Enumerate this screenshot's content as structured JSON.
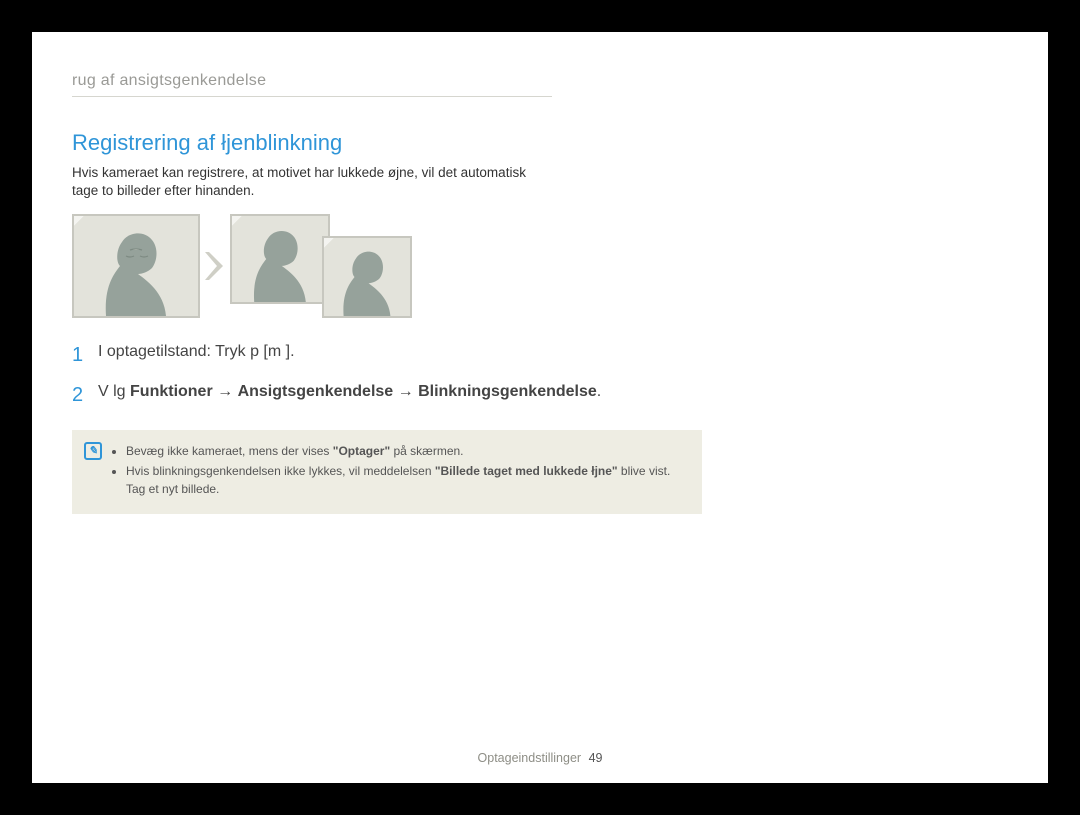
{
  "chapter": "rug af ansigtsgenkendelse",
  "section_title": "Registrering af łjenblinkning",
  "intro": "Hvis kameraet kan registrere, at motivet har lukkede øjne, vil det automatisk tage to billeder efter hinanden.",
  "steps": {
    "s1": {
      "num": "1",
      "text": "I optagetilstand: Tryk p  [m       ]."
    },
    "s2": {
      "num": "2",
      "seg1": "V lg  ",
      "seg2_bold": "Funktioner",
      "seg3": " → ",
      "seg4_bold": "Ansigtsgenkendelse",
      "seg5": " → ",
      "seg6_bold": "Blinkningsgenkendelse",
      "seg7": "."
    }
  },
  "note": {
    "bullet1_pre": "Bevæg ikke kameraet, mens der vises ",
    "bullet1_bold": "\"Optager\"",
    "bullet1_post": " på skærmen.",
    "bullet2_pre": "Hvis blinkningsgenkendelsen ikke lykkes, vil meddelelsen ",
    "bullet2_bold": "\"Billede taget med lukkede łjne\"",
    "bullet2_post": " blive vist. Tag et nyt billede."
  },
  "footer": {
    "section": "Optageindstillinger",
    "page": "49"
  }
}
